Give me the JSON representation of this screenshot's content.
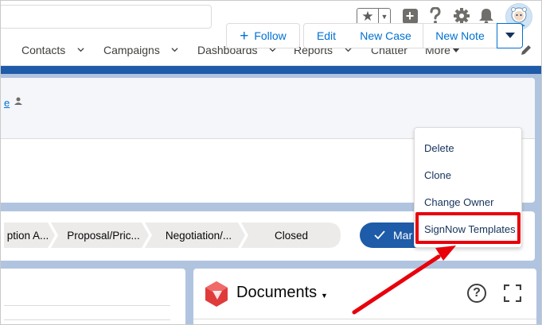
{
  "header": {
    "global_search": {
      "value": ""
    }
  },
  "nav": {
    "items": [
      {
        "label": "Contacts",
        "has_menu": true
      },
      {
        "label": "Campaigns",
        "has_menu": true
      },
      {
        "label": "Dashboards",
        "has_menu": true
      },
      {
        "label": "Reports",
        "has_menu": true
      },
      {
        "label": "Chatter",
        "has_menu": false
      },
      {
        "label": "More",
        "has_menu": true
      }
    ]
  },
  "record_actions": {
    "follow_label": "Follow",
    "edit_label": "Edit",
    "new_case_label": "New Case",
    "new_note_label": "New Note"
  },
  "record": {
    "owner_link_fragment": "e"
  },
  "actions_menu": {
    "items": [
      {
        "label": "Delete"
      },
      {
        "label": "Clone"
      },
      {
        "label": "Change Owner"
      },
      {
        "label": "SignNow Templates",
        "highlighted": true
      }
    ]
  },
  "path": {
    "steps": [
      {
        "label": "ption A..."
      },
      {
        "label": "Proposal/Pric..."
      },
      {
        "label": "Negotiation/..."
      },
      {
        "label": "Closed"
      }
    ],
    "mark_button_label": "Mar"
  },
  "documents": {
    "title": "Documents"
  },
  "colors": {
    "brand_blue": "#1e5ba8",
    "link_blue": "#0070d2",
    "annotation_red": "#e8000b",
    "path_step_bg": "#ecebea"
  }
}
